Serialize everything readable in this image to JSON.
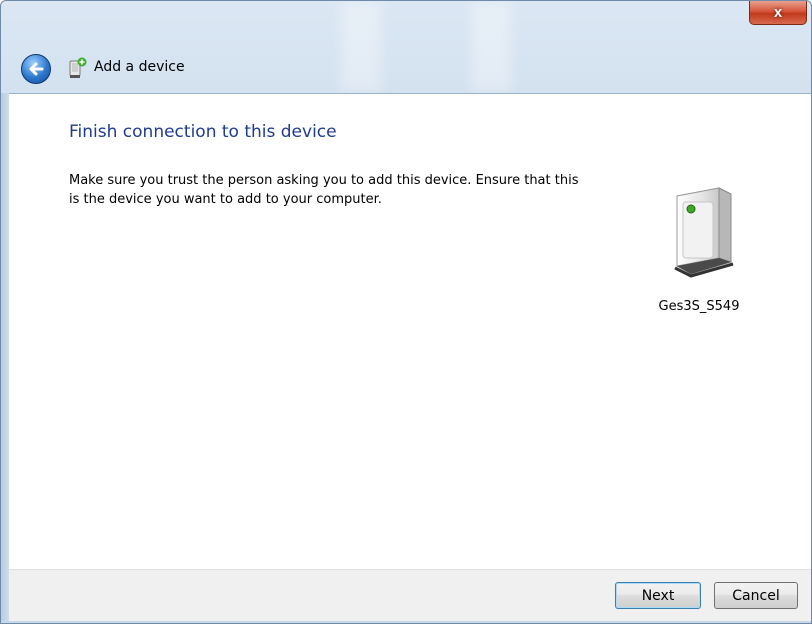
{
  "window": {
    "close_label": "x"
  },
  "header": {
    "title": "Add a device"
  },
  "content": {
    "heading": "Finish connection to this device",
    "message": "Make sure you trust the person asking you to add this device. Ensure that this is the device you want to add to your computer.",
    "device": {
      "name": "Ges3S_S549",
      "icon": "computer-tower-icon"
    }
  },
  "footer": {
    "next_label": "Next",
    "cancel_label": "Cancel"
  },
  "icons": {
    "back": "back-arrow-icon",
    "wizard": "add-device-icon",
    "close": "close-icon"
  },
  "colors": {
    "heading": "#1e3b8f",
    "close_button": "#c23a1c",
    "back_button": "#2d78cc"
  }
}
